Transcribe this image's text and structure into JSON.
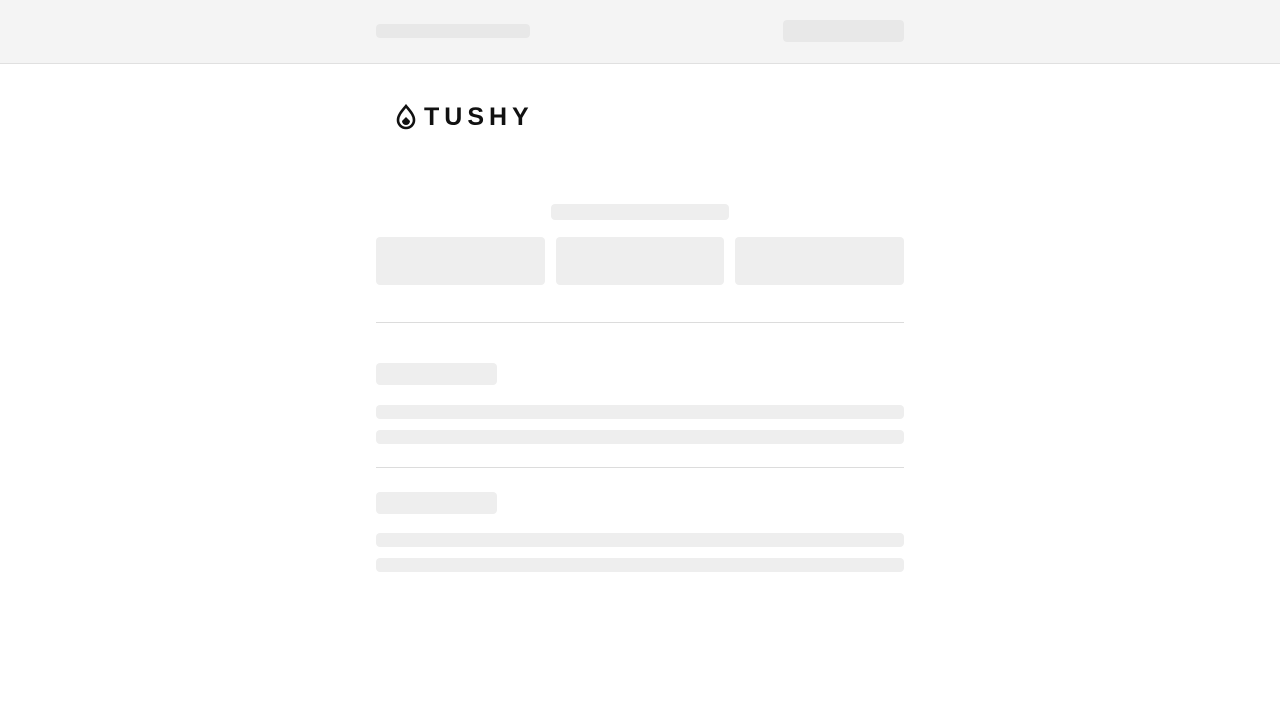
{
  "brand": {
    "logo_text": "TUSHY",
    "logo_icon": "droplet-icon",
    "color": "#111111"
  },
  "colors": {
    "skeleton": "#eeeeee",
    "topbar_background": "#f4f4f4",
    "divider": "#dcdcdc"
  },
  "state": "loading"
}
